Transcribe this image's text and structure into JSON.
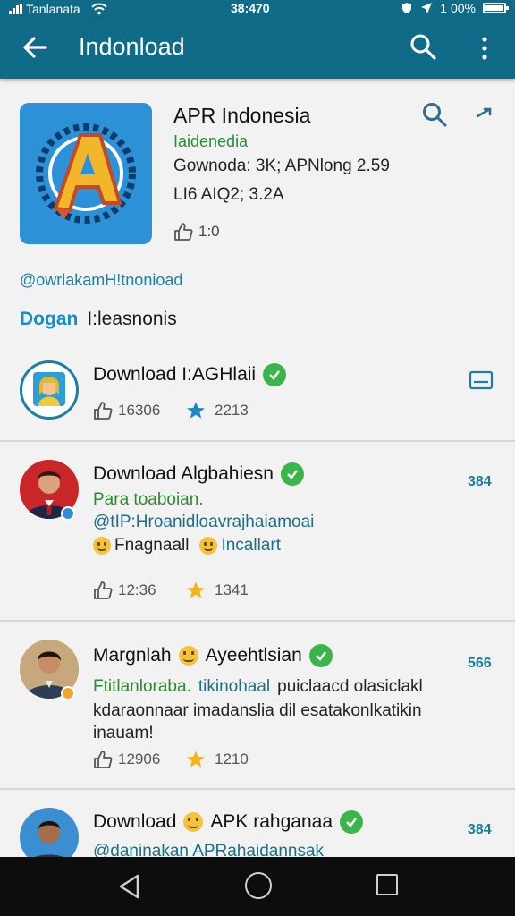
{
  "status_bar": {
    "carrier": "Tanlanata",
    "time": "38:470",
    "battery": "1 00%",
    "battery_level": 1.0
  },
  "app_bar": {
    "title": "Indonload",
    "back_icon": "arrow-left-icon",
    "search_icon": "search-icon",
    "more_icon": "more-vert-icon"
  },
  "header": {
    "app_name": "APR Indonesia",
    "subtitle": "Iaidenedia",
    "meta_line1": "Gownoda: 3K; APNlong 2.59",
    "meta_line2": "LI6 AIQ2; 3.2A",
    "likes": "1:0",
    "icon_letter": "A"
  },
  "handle": "@owrlakamH!tnonioad",
  "section": {
    "highlight": "Dogan",
    "rest": "I:leasnonis"
  },
  "list": {
    "items": [
      {
        "title": "Download I:AGHlaii",
        "likes": "16306",
        "stars": "2213"
      },
      {
        "title": "Download Algbahiesn",
        "count": "384",
        "line1": "Para toaboian.",
        "line2": "@tIP:Hroanidloavrajhaiamoai",
        "line3_a": "Fnagnaall",
        "line3_b": "Incallart",
        "likes": "12:36",
        "stars": "1341"
      },
      {
        "title_a": "Margnlah",
        "title_b": "Ayeehtlsian",
        "count": "566",
        "line1_a": "Ftitlanloraba.",
        "line1_b": "tikinohaal",
        "line1_c": "puiclaacd olasiclakl",
        "line2": "kdaraonnaar imadanslia dil esatakonlkatikin",
        "line3": "inauam!",
        "likes": "12906",
        "stars": "1210"
      },
      {
        "title_a": "Download",
        "title_b": "APK rahganaa",
        "count": "384",
        "line1": "@daninakan APRahaidannsak"
      }
    ]
  },
  "colors": {
    "primary": "#0f6b87",
    "accent_green": "#3bb54a",
    "star": "#f5b21b"
  }
}
